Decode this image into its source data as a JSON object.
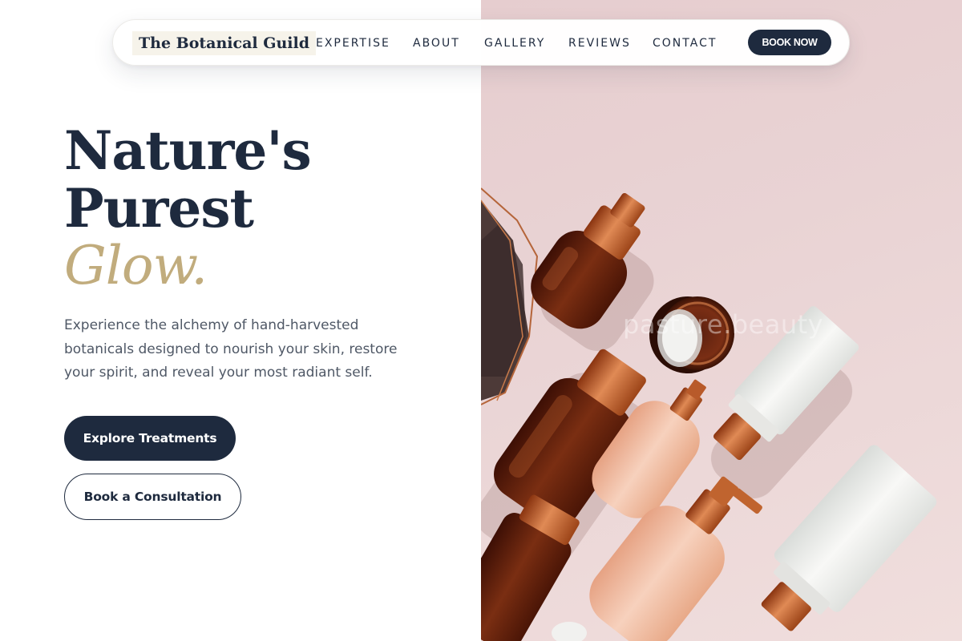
{
  "nav": {
    "brand": "The Botanical Guild",
    "links": [
      "EXPERTISE",
      "ABOUT",
      "GALLERY",
      "REVIEWS",
      "CONTACT"
    ],
    "cta_label": "BOOK NOW"
  },
  "hero": {
    "title_line1": "Nature's",
    "title_line2": "Purest",
    "title_accent": "Glow.",
    "description": "Experience the alchemy of hand-harvested botanicals designed to nourish your skin, restore your spirit, and reveal your most radiant self.",
    "primary_cta": "Explore Treatments",
    "secondary_cta": "Book a Consultation"
  },
  "image": {
    "watermark": "pasture.beauty",
    "subject": "skincare-products-flatlay"
  },
  "colors": {
    "navy": "#1e2a3e",
    "gold": "#c1ac7d",
    "body_text": "#4f5866",
    "photo_bg": "#e9d3d4",
    "copper": "#c2622e"
  }
}
